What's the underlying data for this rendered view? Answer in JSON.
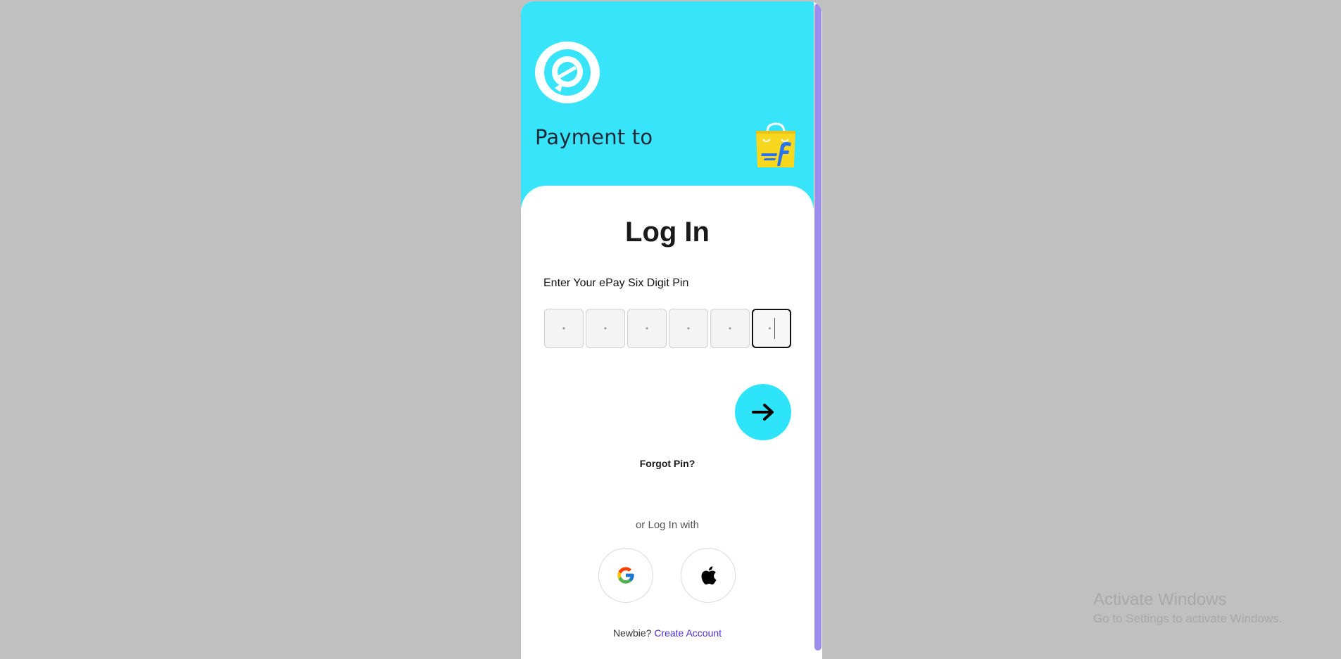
{
  "header": {
    "payment_to": "Payment to",
    "background_color": "#38e4fa",
    "logo_icon": "epay-logo-icon",
    "merchant_icon": "flipkart-shopping-bag-icon"
  },
  "login": {
    "title": "Log In",
    "pin_label": "Enter Your ePay Six Digit Pin",
    "pin_placeholders": [
      "•",
      "•",
      "•",
      "•",
      "•",
      "•"
    ],
    "submit_icon": "arrow-right-icon",
    "forgot_pin": "Forgot Pin?",
    "or_login_with": "or Log In with",
    "social": {
      "google_icon": "google-icon",
      "apple_icon": "apple-icon"
    },
    "signup_prompt": "Newbie?",
    "signup_link": "Create Account",
    "accent_color": "#2ee4fb",
    "link_color": "#4b2fd6"
  },
  "watermark": {
    "title": "Activate Windows",
    "subtitle": "Go to Settings to activate Windows."
  }
}
